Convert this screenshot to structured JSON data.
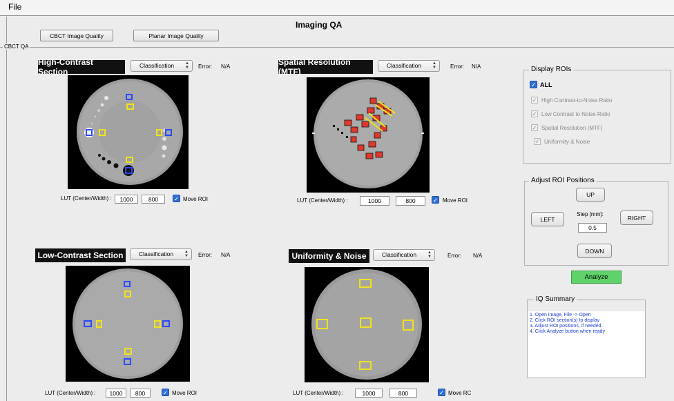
{
  "menu": {
    "file": "File"
  },
  "window_title": "Imaging QA",
  "top_buttons": {
    "cbct": "CBCT Image Quality",
    "planar": "Planar Image Quality"
  },
  "group_label": "CBCT QA",
  "sections": {
    "high_contrast": {
      "title": "High-Contrast Section",
      "dropdown": "Classification",
      "error_label": "Error:",
      "error_value": "N/A",
      "lut_label": "LUT (Center/Width) :",
      "center": "1000",
      "width": "800",
      "move_roi": "Move ROI"
    },
    "spatial": {
      "title": "Spatial Resolution (MTF)",
      "dropdown": "Classification",
      "error_label": "Error:",
      "error_value": "N/A",
      "lut_label": "LUT (Center/Width) :",
      "center": "1000",
      "width": "800",
      "move_roi": "Move ROI"
    },
    "low_contrast": {
      "title": "Low-Contrast Section",
      "dropdown": "Classification",
      "error_label": "Error:",
      "error_value": "N/A",
      "lut_label": "LUT (Center/Width) :",
      "center": "1000",
      "width": "800",
      "move_roi": "Move ROI"
    },
    "uniformity": {
      "title": "Uniformity & Noise",
      "dropdown": "Classification",
      "error_label": "Error:",
      "error_value": "N/A",
      "lut_label": "LUT (Center/Width) :",
      "center": "1000",
      "width": "800",
      "move_roi": "Move RC"
    }
  },
  "display_rois": {
    "title": "Display ROIs",
    "items": [
      {
        "label": "ALL",
        "checked": true,
        "enabled": true
      },
      {
        "label": "High Contrast-to-Noise Ratio",
        "checked": true,
        "enabled": false
      },
      {
        "label": "Low Contrast to Noise Ratio",
        "checked": true,
        "enabled": false
      },
      {
        "label": "Spatial Resolution (MTF)",
        "checked": true,
        "enabled": false
      },
      {
        "label": "Uniformity & Noise",
        "checked": true,
        "enabled": false
      }
    ]
  },
  "adjust": {
    "title": "Adjust ROI Positions",
    "up": "UP",
    "down": "DOWN",
    "left": "LEFT",
    "right": "RIGHT",
    "step_label": "Step [mm]:",
    "step_value": "0.5"
  },
  "analyze_label": "Analyze",
  "analyze_color": "#5fd36a",
  "summary": {
    "title": "IQ Summary",
    "lines": [
      "1. Open image, File -> Open",
      "2. Click ROI section(s) to display",
      "3. Adjust ROI positions, if needed",
      "4. Click Analyze button when ready"
    ]
  },
  "colors": {
    "roi_yellow": "#f2e21b",
    "roi_blue": "#2a49ff",
    "roi_red": "#e0382a"
  }
}
